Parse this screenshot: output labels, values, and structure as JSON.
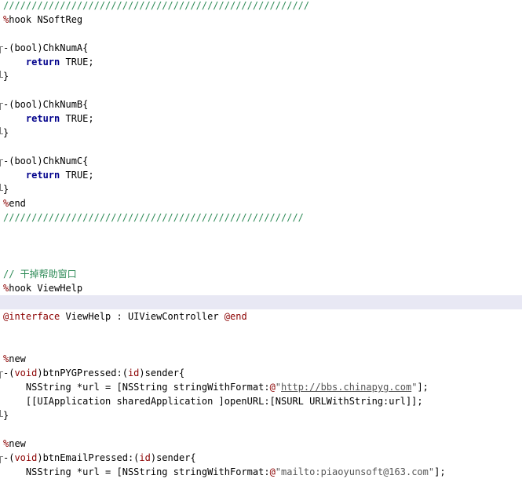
{
  "editor": {
    "lines": [
      {
        "segs": [
          {
            "c": "comment",
            "t": "//////////////////////////////////////////////////////"
          }
        ]
      },
      {
        "segs": [
          {
            "c": "dir",
            "t": "%"
          },
          {
            "c": "",
            "t": "hook NSoftReg"
          }
        ]
      },
      {
        "segs": []
      },
      {
        "fold": "start",
        "segs": [
          {
            "c": "",
            "t": "-(bool)ChkNumA{"
          }
        ]
      },
      {
        "segs": [
          {
            "c": "",
            "t": "    "
          },
          {
            "c": "kw",
            "t": "return"
          },
          {
            "c": "",
            "t": " TRUE;"
          }
        ]
      },
      {
        "fold": "end",
        "segs": [
          {
            "c": "",
            "t": "}"
          }
        ]
      },
      {
        "segs": []
      },
      {
        "fold": "start",
        "segs": [
          {
            "c": "",
            "t": "-(bool)ChkNumB{"
          }
        ]
      },
      {
        "segs": [
          {
            "c": "",
            "t": "    "
          },
          {
            "c": "kw",
            "t": "return"
          },
          {
            "c": "",
            "t": " TRUE;"
          }
        ]
      },
      {
        "fold": "end",
        "segs": [
          {
            "c": "",
            "t": "}"
          }
        ]
      },
      {
        "segs": []
      },
      {
        "fold": "start",
        "segs": [
          {
            "c": "",
            "t": "-(bool)ChkNumC{"
          }
        ]
      },
      {
        "segs": [
          {
            "c": "",
            "t": "    "
          },
          {
            "c": "kw",
            "t": "return"
          },
          {
            "c": "",
            "t": " TRUE;"
          }
        ]
      },
      {
        "fold": "end",
        "segs": [
          {
            "c": "",
            "t": "}"
          }
        ]
      },
      {
        "segs": [
          {
            "c": "dir",
            "t": "%"
          },
          {
            "c": "",
            "t": "end"
          }
        ]
      },
      {
        "segs": [
          {
            "c": "comment",
            "t": "/////////////////////////////////////////////////////"
          }
        ]
      },
      {
        "segs": []
      },
      {
        "segs": []
      },
      {
        "segs": []
      },
      {
        "segs": [
          {
            "c": "comment",
            "t": "// 干掉帮助窗口"
          }
        ]
      },
      {
        "segs": [
          {
            "c": "dir",
            "t": "%"
          },
          {
            "c": "",
            "t": "hook ViewHelp"
          }
        ]
      },
      {
        "current": true,
        "segs": []
      },
      {
        "segs": [
          {
            "c": "dir",
            "t": "@interface"
          },
          {
            "c": "",
            "t": " ViewHelp : UIViewController "
          },
          {
            "c": "dir",
            "t": "@end"
          }
        ]
      },
      {
        "segs": []
      },
      {
        "segs": []
      },
      {
        "segs": [
          {
            "c": "dir",
            "t": "%"
          },
          {
            "c": "",
            "t": "new"
          }
        ]
      },
      {
        "fold": "start",
        "segs": [
          {
            "c": "",
            "t": "-("
          },
          {
            "c": "type",
            "t": "void"
          },
          {
            "c": "",
            "t": ")btnPYGPressed:("
          },
          {
            "c": "type",
            "t": "id"
          },
          {
            "c": "",
            "t": ")sender{"
          }
        ]
      },
      {
        "segs": [
          {
            "c": "",
            "t": "    NSString *url = [NSString stringWithFormat:"
          },
          {
            "c": "dir",
            "t": "@"
          },
          {
            "c": "str",
            "t": "\""
          },
          {
            "c": "url",
            "t": "http://bbs.chinapyg.com"
          },
          {
            "c": "str",
            "t": "\""
          },
          {
            "c": "",
            "t": "];"
          }
        ]
      },
      {
        "segs": [
          {
            "c": "",
            "t": "    [[UIApplication sharedApplication ]openURL:[NSURL URLWithString:url]];"
          }
        ]
      },
      {
        "fold": "end",
        "segs": [
          {
            "c": "",
            "t": "}"
          }
        ]
      },
      {
        "segs": []
      },
      {
        "segs": [
          {
            "c": "dir",
            "t": "%"
          },
          {
            "c": "",
            "t": "new"
          }
        ]
      },
      {
        "fold": "start",
        "segs": [
          {
            "c": "",
            "t": "-("
          },
          {
            "c": "type",
            "t": "void"
          },
          {
            "c": "",
            "t": ")btnEmailPressed:("
          },
          {
            "c": "type",
            "t": "id"
          },
          {
            "c": "",
            "t": ")sender{"
          }
        ]
      },
      {
        "segs": [
          {
            "c": "",
            "t": "    NSString *url = [NSString stringWithFormat:"
          },
          {
            "c": "dir",
            "t": "@"
          },
          {
            "c": "str",
            "t": "\"mailto:piaoyunsoft@163.com\""
          },
          {
            "c": "",
            "t": "];"
          }
        ]
      }
    ]
  }
}
